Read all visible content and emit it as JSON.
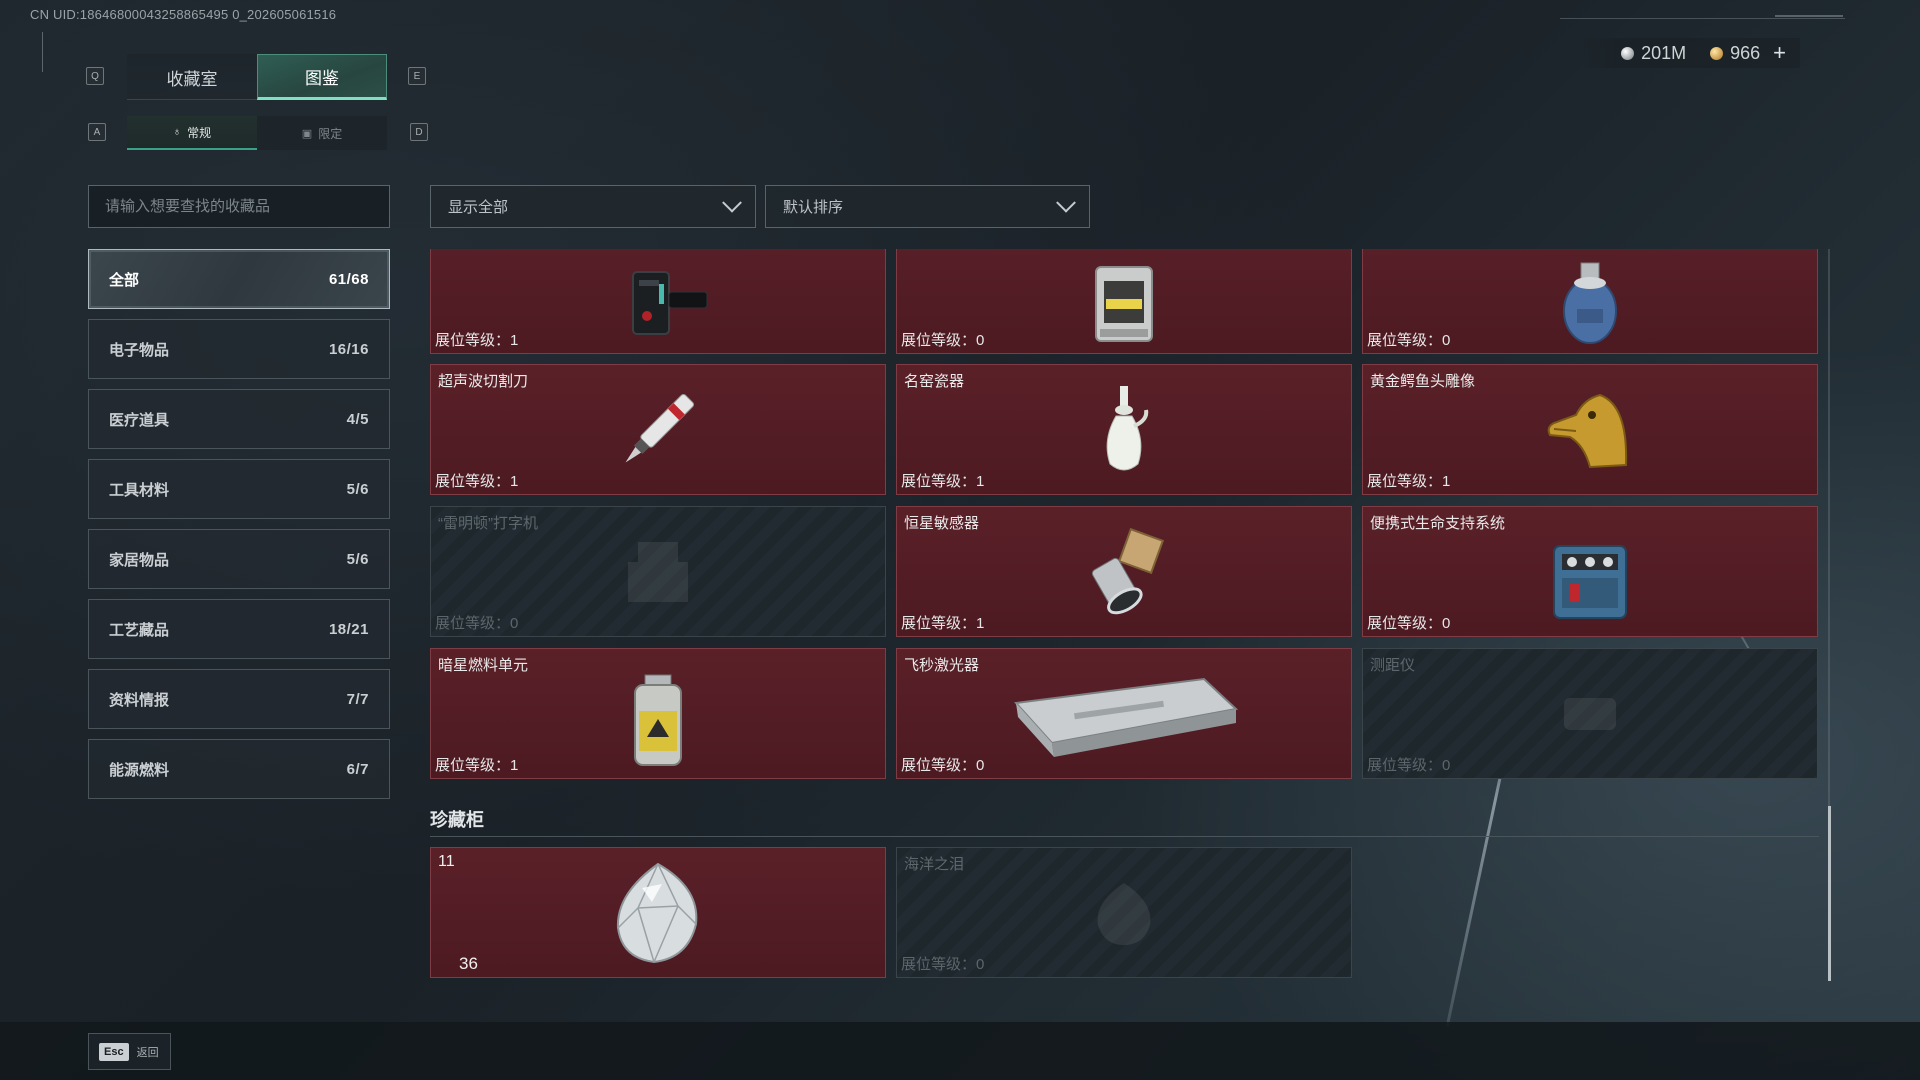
{
  "uid": "CN UID:18646800043258865495 0_202605061516",
  "currency": {
    "silver": "201M",
    "gold": "966",
    "plus": "+"
  },
  "keys": {
    "prev_tab": "Q",
    "next_tab": "E",
    "prev_sub": "A",
    "next_sub": "D"
  },
  "tabs": [
    {
      "label": "收藏室"
    },
    {
      "label": "图鉴"
    }
  ],
  "active_tab": "图鉴",
  "subtabs": [
    {
      "label": "常规",
      "icon": "♁"
    },
    {
      "label": "限定",
      "icon": "▣"
    }
  ],
  "search": {
    "placeholder": "请输入想要查找的收藏品"
  },
  "filter": {
    "value": "显示全部"
  },
  "sort": {
    "value": "默认排序"
  },
  "categories": [
    {
      "name": "全部",
      "count": "61/68",
      "active": true
    },
    {
      "name": "电子物品",
      "count": "16/16"
    },
    {
      "name": "医疗道具",
      "count": "4/5"
    },
    {
      "name": "工具材料",
      "count": "5/6"
    },
    {
      "name": "家居物品",
      "count": "5/6"
    },
    {
      "name": "工艺藏品",
      "count": "18/21"
    },
    {
      "name": "资料情报",
      "count": "7/7"
    },
    {
      "name": "能源燃料",
      "count": "6/7"
    }
  ],
  "items": [
    {
      "name": "",
      "level": "展位等级：1",
      "icon": "tracker-device-icon",
      "locked": false
    },
    {
      "name": "",
      "level": "展位等级：0",
      "icon": "lantern-icon",
      "locked": false
    },
    {
      "name": "",
      "level": "展位等级：0",
      "icon": "gas-canister-icon",
      "locked": false
    },
    {
      "name": "超声波切割刀",
      "level": "展位等级：1",
      "icon": "ultrasonic-cutter-icon",
      "locked": false
    },
    {
      "name": "名窑瓷器",
      "level": "展位等级：1",
      "icon": "porcelain-vase-icon",
      "locked": false
    },
    {
      "name": "黄金鳄鱼头雕像",
      "level": "展位等级：1",
      "icon": "gold-crocodile-head-icon",
      "locked": false
    },
    {
      "name": "“雷明顿”打字机",
      "level": "展位等级：0",
      "icon": "typewriter-icon",
      "locked": true
    },
    {
      "name": "恒星敏感器",
      "level": "展位等级：1",
      "icon": "star-sensor-icon",
      "locked": false
    },
    {
      "name": "便携式生命支持系统",
      "level": "展位等级：0",
      "icon": "life-support-icon",
      "locked": false
    },
    {
      "name": "暗星燃料单元",
      "level": "展位等级：1",
      "icon": "fuel-cell-icon",
      "locked": false
    },
    {
      "name": "飞秒激光器",
      "level": "展位等级：0",
      "icon": "femtosecond-laser-icon",
      "locked": false
    },
    {
      "name": "测距仪",
      "level": "展位等级：0",
      "icon": "rangefinder-icon",
      "locked": true
    }
  ],
  "treasure": {
    "title": "珍藏柜",
    "items": [
      {
        "num": "11",
        "count": "36",
        "icon": "diamond-icon",
        "locked": false
      },
      {
        "name": "海洋之泪",
        "level": "展位等级：0",
        "icon": "ocean-tear-icon",
        "locked": true
      }
    ]
  },
  "footer": {
    "key": "Esc",
    "label": "返回"
  }
}
